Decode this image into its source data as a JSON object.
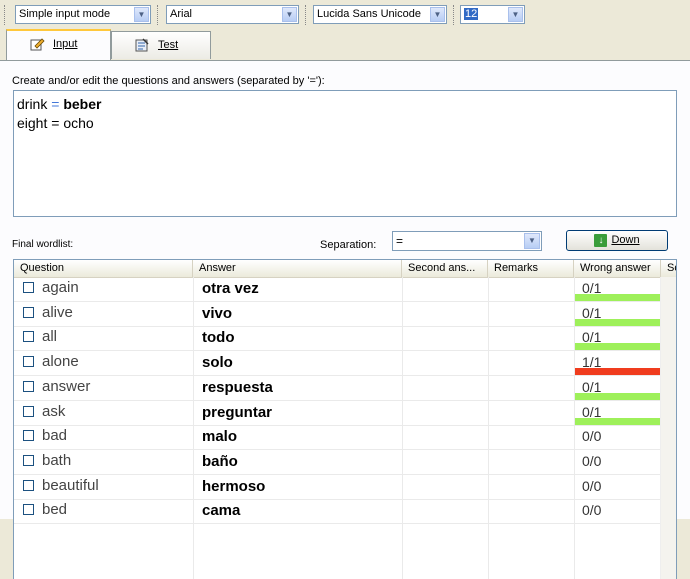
{
  "toolbar": {
    "mode": "Simple input mode",
    "font1": "Arial",
    "font2": "Lucida Sans Unicode",
    "size": "12"
  },
  "tabs": [
    {
      "label": "Input",
      "icon": "pencil-icon",
      "active": true
    },
    {
      "label": "Test",
      "icon": "test-icon",
      "active": false
    }
  ],
  "editor": {
    "prompt": "Create and/or edit the questions and answers (separated by '='):",
    "lines": [
      {
        "question": "drink",
        "separator": "=",
        "answer": "beber"
      },
      {
        "question": "eight",
        "separator": "=",
        "answer": "ocho"
      }
    ]
  },
  "wordlist": {
    "label": "Final wordlist:",
    "separation_label": "Separation:",
    "separation_value": "=",
    "down_button": "Down",
    "columns": [
      "Question",
      "Answer",
      "Second ans...",
      "Remarks",
      "Wrong answer",
      "Sc"
    ],
    "rows": [
      {
        "question": "again",
        "answer": "otra vez",
        "wrong": "0/1",
        "bar": "green"
      },
      {
        "question": "alive",
        "answer": "vivo",
        "wrong": "0/1",
        "bar": "green"
      },
      {
        "question": "all",
        "answer": "todo",
        "wrong": "0/1",
        "bar": "green"
      },
      {
        "question": "alone",
        "answer": "solo",
        "wrong": "1/1",
        "bar": "red"
      },
      {
        "question": "answer",
        "answer": "respuesta",
        "wrong": "0/1",
        "bar": "green"
      },
      {
        "question": "ask",
        "answer": "preguntar",
        "wrong": "0/1",
        "bar": "green"
      },
      {
        "question": "bad",
        "answer": "malo",
        "wrong": "0/0",
        "bar": ""
      },
      {
        "question": "bath",
        "answer": "baño",
        "wrong": "0/0",
        "bar": ""
      },
      {
        "question": "beautiful",
        "answer": "hermoso",
        "wrong": "0/0",
        "bar": ""
      },
      {
        "question": "bed",
        "answer": "cama",
        "wrong": "0/0",
        "bar": ""
      }
    ]
  },
  "colors": {
    "green": "#9ef05a",
    "red": "#f03c1e",
    "accent": "#316ac5"
  }
}
